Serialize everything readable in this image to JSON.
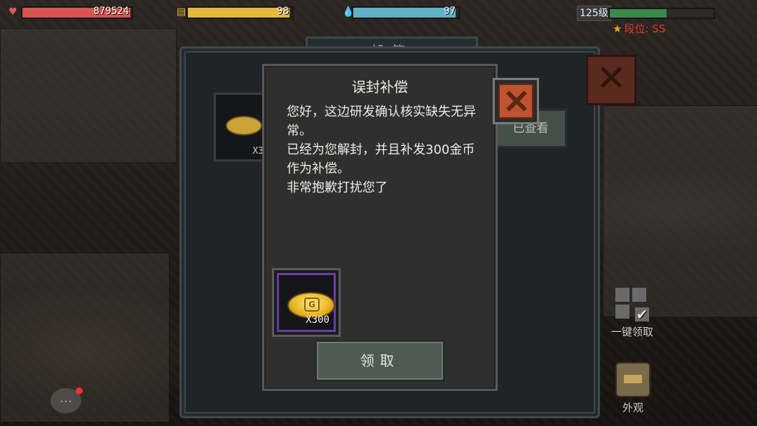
{
  "hud": {
    "health": {
      "icon": "heart-icon",
      "value": "879524",
      "fill": 0.99,
      "color": "#d9534f"
    },
    "food": {
      "icon": "burger-icon",
      "value": "98",
      "fill": 0.98,
      "color": "#e6b93c"
    },
    "water": {
      "icon": "water-drop-icon",
      "value": "97",
      "fill": 0.97,
      "color": "#5fb3c8"
    },
    "level": {
      "label": "125级",
      "exp_fill": 0.55,
      "color": "#3a8a4a"
    },
    "rank": {
      "label": "段位: SS",
      "icon": "star-icon"
    }
  },
  "mailbox": {
    "tab_label": "邮箱",
    "background_item_qty": "X3",
    "view_button_label": "已查看"
  },
  "dialog": {
    "title": "误封补偿",
    "lines": [
      "您好，这边研发确认核实缺失无异常。",
      "已经为您解封，并且补发300金币作为补偿。",
      "非常抱歉打扰您了"
    ],
    "reward": {
      "icon": "gold-coin-icon",
      "quantity": "X300"
    },
    "claim_label": "领取"
  },
  "side": {
    "claim_all_label": "一键领取",
    "appearance_label": "外观"
  }
}
